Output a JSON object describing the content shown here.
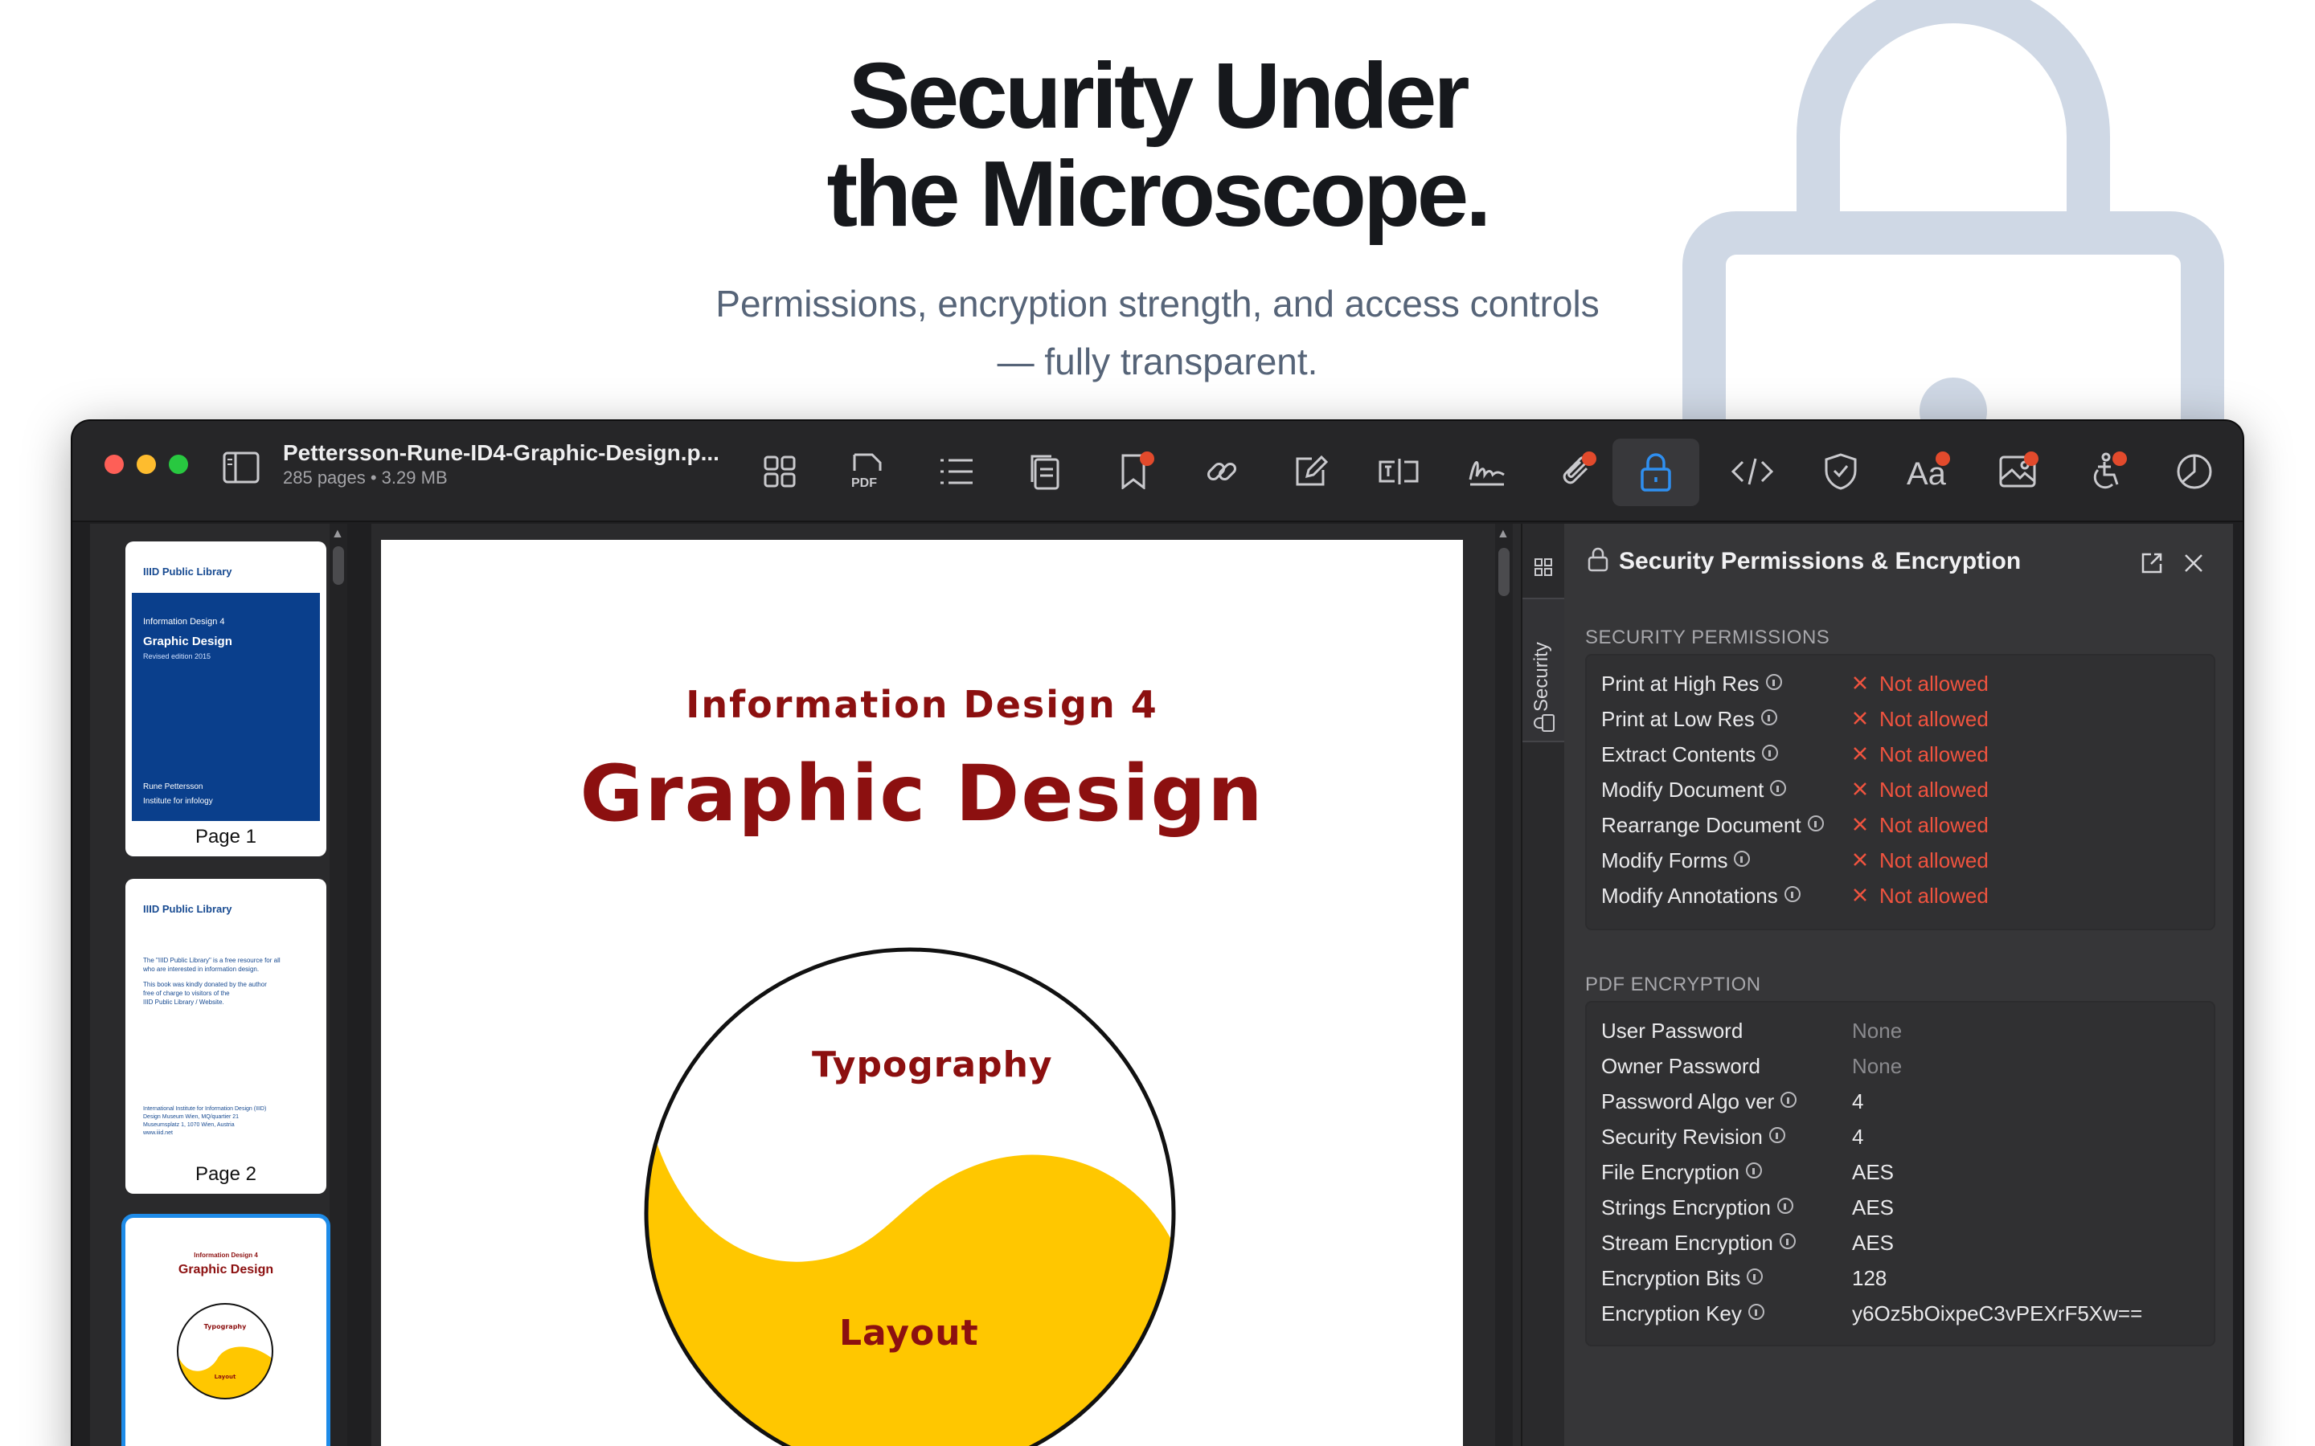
{
  "hero": {
    "title_line1": "Security Under",
    "title_line2": "the Microscope.",
    "subtitle_line1": "Permissions, encryption strength, and access controls",
    "subtitle_line2": "— fully transparent."
  },
  "window": {
    "doc_title": "Pettersson-Rune-ID4-Graphic-Design.p...",
    "doc_meta": "285 pages • 3.29 MB",
    "toolbar_icons": [
      "sidebar-toggle-icon",
      "grid-icon",
      "pdf-icon",
      "list-icon",
      "pages-icon",
      "bookmark-icon",
      "link-icon",
      "edit-icon",
      "form-field-icon",
      "signature-icon",
      "attachment-icon",
      "lock-icon",
      "code-icon",
      "shield-icon",
      "font-icon",
      "image-icon",
      "accessibility-icon",
      "pie-chart-icon"
    ],
    "active_tool": "lock-icon"
  },
  "sidebar": {
    "thumbs": [
      {
        "label": "Page 1",
        "lib": "IIID Public Library",
        "heading": "Information Design 4",
        "title": "Graphic Design",
        "edition": "Revised edition 2015",
        "author": "Rune Pettersson",
        "institute": "Institute for infology"
      },
      {
        "label": "Page 2",
        "lib": "IIID Public Library",
        "para1_line1": "The \"IIID Public Library\" is a free resource for all",
        "para1_line2": "who are interested in information design.",
        "para2_line1": "This book was kindly donated by the author",
        "para2_line2": "free of charge to visitors of the",
        "para2_line3": "IIID Public Library / Website.",
        "addr_line1": "International Institute for Information Design (IIID)",
        "addr_line2": "Design Museum Wien, MQ/quartier 21",
        "addr_line3": "Museumsplatz 1, 1070 Wien, Austria",
        "addr_line4": "www.iiid.net"
      },
      {
        "heading": "Information Design 4",
        "title": "Graphic Design",
        "circle_top": "Typography",
        "circle_bottom": "Layout"
      }
    ]
  },
  "page": {
    "subtitle": "Information Design 4",
    "title": "Graphic Design",
    "circle_top": "Typography",
    "circle_bottom": "Layout"
  },
  "tabs": {
    "security_tab": "Security"
  },
  "panel": {
    "title": "Security Permissions & Encryption",
    "permissions_heading": "SECURITY PERMISSIONS",
    "permissions": [
      {
        "label": "Print at High Res",
        "value": "Not allowed"
      },
      {
        "label": "Print at Low Res",
        "value": "Not allowed"
      },
      {
        "label": "Extract Contents",
        "value": "Not allowed"
      },
      {
        "label": "Modify Document",
        "value": "Not allowed"
      },
      {
        "label": "Rearrange Document",
        "value": "Not allowed"
      },
      {
        "label": "Modify Forms",
        "value": "Not allowed"
      },
      {
        "label": "Modify Annotations",
        "value": "Not allowed"
      }
    ],
    "encryption_heading": "PDF ENCRYPTION",
    "encryption": [
      {
        "label": "User Password",
        "value": "None"
      },
      {
        "label": "Owner Password",
        "value": "None"
      },
      {
        "label": "Password Algo ver",
        "value": "4"
      },
      {
        "label": "Security Revision",
        "value": "4"
      },
      {
        "label": "File Encryption",
        "value": "AES"
      },
      {
        "label": "Strings Encryption",
        "value": "AES"
      },
      {
        "label": "Stream Encryption",
        "value": "AES"
      },
      {
        "label": "Encryption Bits",
        "value": "128"
      },
      {
        "label": "Encryption Key",
        "value": "y6Oz5bOixpeC3vPEXrF5Xw=="
      }
    ]
  },
  "colors": {
    "accent": "#1e8be8",
    "denied": "#f0533f",
    "doc_red": "#8c1010",
    "yellow": "#ffc700",
    "lock_bg": "#cfd8e5"
  }
}
